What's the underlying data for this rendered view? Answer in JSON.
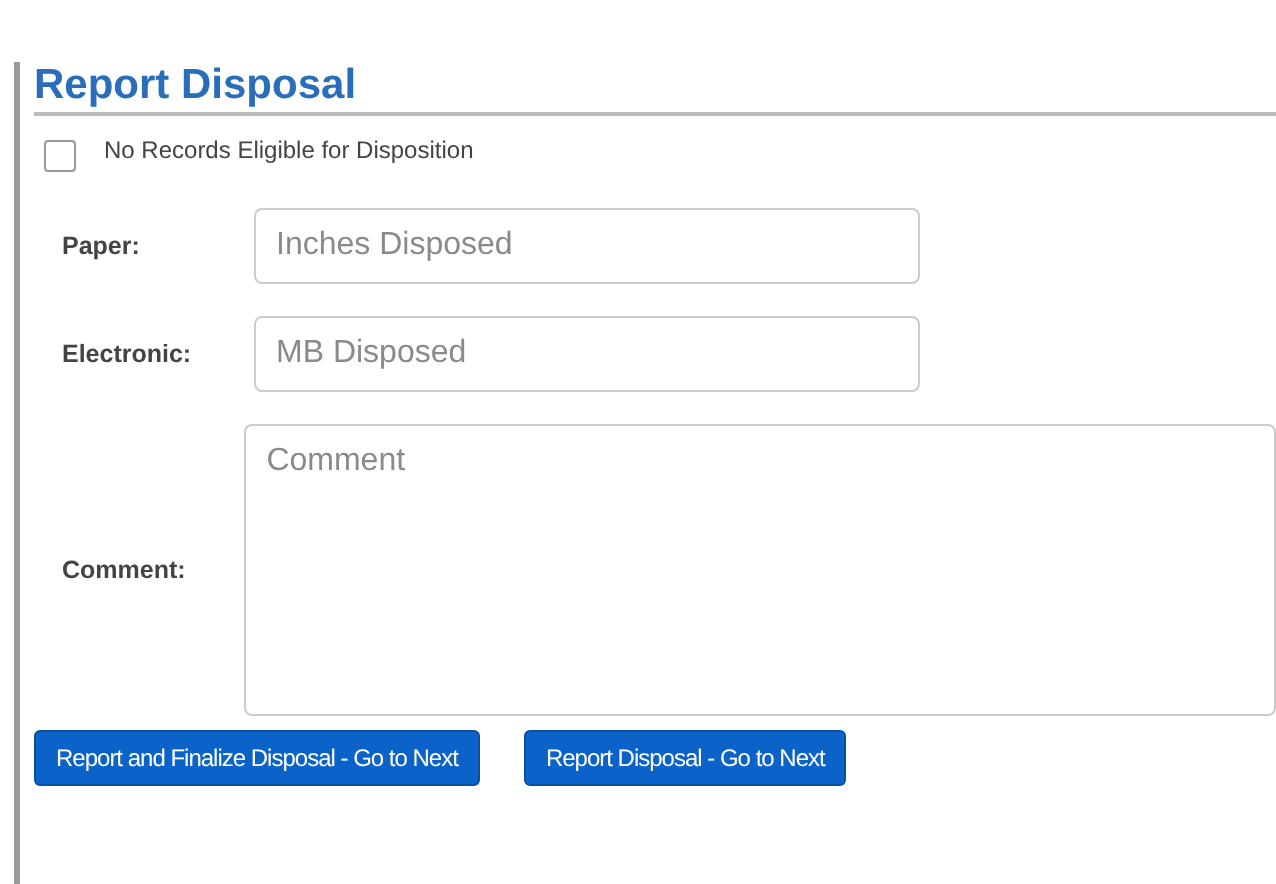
{
  "heading": "Report Disposal",
  "no_records": {
    "label": "No Records Eligible for Disposition",
    "checked": false
  },
  "fields": [
    {
      "label": "Paper:",
      "placeholder": "Inches Disposed",
      "kind": "input"
    },
    {
      "label": "Electronic:",
      "placeholder": "MB Disposed",
      "kind": "input"
    },
    {
      "label": "Comment:",
      "placeholder": "Comment",
      "kind": "textarea"
    }
  ],
  "buttons": [
    "Report and Finalize Disposal - Go to Next",
    "Report Disposal - Go to Next"
  ]
}
